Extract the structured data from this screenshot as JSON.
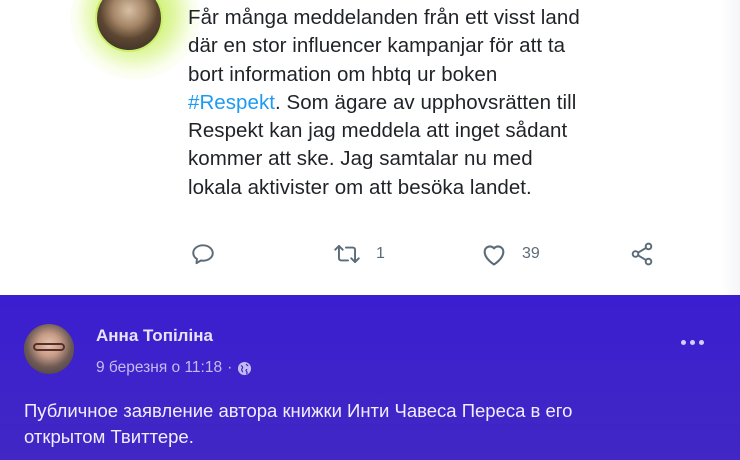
{
  "tweet": {
    "lines": [
      "Får många meddelanden från ett visst land",
      "där en stor influencer kampanjar för att ta",
      "bort information om hbtq ur boken"
    ],
    "hashtag": "#Respekt",
    "line4_rest": ". Som ägare av upphovsrätten till",
    "lines_after": [
      "Respekt kan jag meddela att inget sådant",
      "kommer att ske. Jag samtalar nu med",
      "lokala aktivister om att besöka landet."
    ],
    "actions": {
      "reply_icon": "reply-icon",
      "retweet_icon": "retweet-icon",
      "retweet_count": "1",
      "like_icon": "heart-icon",
      "like_count": "39",
      "share_icon": "share-icon"
    },
    "colors": {
      "hashtag": "#1d9bf0",
      "avatar_ring": "#c9ef6a"
    }
  },
  "facebook_post": {
    "author": "Анна Топіліна",
    "date": "9 березня о 11:18",
    "separator": "·",
    "privacy_icon": "globe-icon",
    "more_icon": "more-options-icon",
    "text_lines": [
      "Публичное заявление автора книжки Инти Чавеса Переса в его",
      "открытом Твиттере."
    ],
    "colors": {
      "background": "#3f22c8",
      "text": "#f1eefe",
      "meta": "#c3bcf0"
    }
  }
}
